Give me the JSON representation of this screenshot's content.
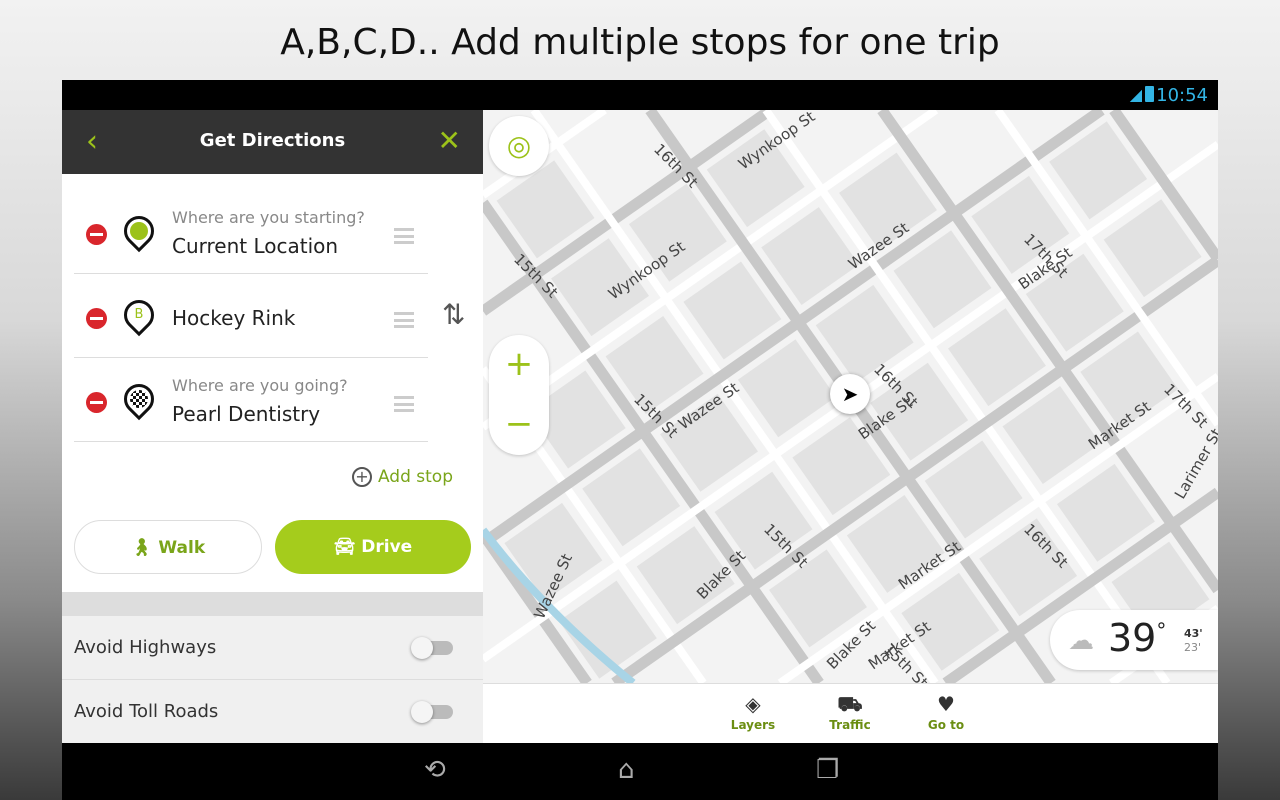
{
  "headline": "A,B,C,D.. Add multiple stops for one trip",
  "status": {
    "time": "10:54",
    "wifi_icon": "wifi-icon",
    "battery_icon": "battery-icon"
  },
  "panel": {
    "title": "Get Directions",
    "back_icon": "chevron-left-icon",
    "close_icon": "close-icon",
    "stops": [
      {
        "placeholder": "Where are you starting?",
        "value": "Current Location",
        "pin": "current-location-pin"
      },
      {
        "placeholder": "",
        "value": "Hockey Rink",
        "pin_letter": "B"
      },
      {
        "placeholder": "Where are you going?",
        "value": "Pearl Dentistry",
        "pin": "checkered-flag-pin"
      }
    ],
    "add_stop": "Add stop",
    "walk": "Walk",
    "drive": "Drive",
    "options": [
      {
        "label": "Avoid Highways",
        "on": false
      },
      {
        "label": "Avoid Toll Roads",
        "on": false
      }
    ]
  },
  "map": {
    "streets": [
      "Wynkoop St",
      "Wynkoop St",
      "15th St",
      "15th St",
      "15th St",
      "15th St",
      "16th St",
      "16th St",
      "16th St",
      "17th St",
      "17th St",
      "Wazee St",
      "Wazee St",
      "Wazee St",
      "Blake St",
      "Blake St",
      "Blake St",
      "Blake St",
      "Market St",
      "Market St",
      "Market St",
      "Larimer St"
    ],
    "weather": {
      "temp": "39",
      "unit": "°",
      "high": "43'",
      "low": "23'"
    }
  },
  "bottom_bar": [
    {
      "label": "Layers"
    },
    {
      "label": "Traffic"
    },
    {
      "label": "Go to"
    }
  ],
  "accent": "#a5cc1c"
}
